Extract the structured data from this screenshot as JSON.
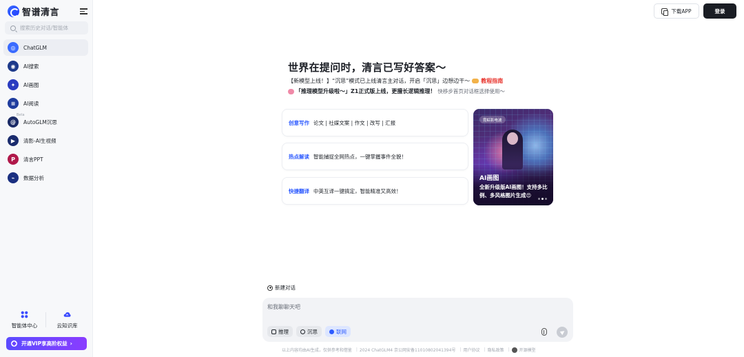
{
  "app": {
    "logo_text": "智谱清言"
  },
  "sidebar": {
    "search_placeholder": "搜索历史对话/智能体",
    "items": [
      {
        "label": "ChatGLM",
        "icon": "chatglm-icon",
        "color": "#3a6bff",
        "active": true
      },
      {
        "label": "AI搜索",
        "icon": "ai-search-icon",
        "color": "#1d3a8a"
      },
      {
        "label": "AI画图",
        "icon": "ai-draw-icon",
        "color": "#2a3cc0"
      },
      {
        "label": "AI阅读",
        "icon": "ai-read-icon",
        "color": "#1f3c9e"
      },
      {
        "label": "AutoGLM沉思",
        "icon": "autoglm-icon",
        "color": "#1a2a66",
        "badge": "Beta"
      },
      {
        "label": "清影-AI生视频",
        "icon": "video-icon",
        "color": "#1b2c6e"
      },
      {
        "label": "清言PPT",
        "icon": "ppt-icon",
        "color": "#b0184a"
      },
      {
        "label": "数据分析",
        "icon": "data-analysis-icon",
        "color": "#1a2f80"
      }
    ],
    "tools": [
      {
        "label": "智能体中心",
        "icon": "agent-center-icon"
      },
      {
        "label": "云知识库",
        "icon": "cloud-kb-icon"
      }
    ],
    "vip_label": "开通VIP享高阶权益"
  },
  "header": {
    "download_label": "下载APP",
    "login_label": "登录"
  },
  "hero": {
    "title": "世界在提问时，清言已写好答案～",
    "notice1_bold": "【新模型上线！】“沉思”模式已上线清言主对话，开启「沉思」边想边干～",
    "notice1_link": "教程指南",
    "notice2_bold": "「推理模型升级啦～」Z1正式版上线，更擅长逻辑推理！",
    "notice2_gray": "快移步首页对话框选择使用～"
  },
  "cards": [
    {
      "tag": "创意写作",
      "text": "论文 | 社媒文案 | 作文 | 改写 | 汇报"
    },
    {
      "tag": "热点解读",
      "text": "智能捕捉全网热点，一键掌握事件全貌！"
    },
    {
      "tag": "快捷翻译",
      "text": "中英互译一键搞定，智能精准又高效！"
    }
  ],
  "promo": {
    "badge": "霓虹影电波",
    "heading": "AI画图",
    "desc": "全新升级版AI画图！支持多比例、多风格图片生成😍"
  },
  "chat": {
    "new_chat_label": "新建对话",
    "input_placeholder": "和我聊聊天吧",
    "modes": [
      {
        "label": "推理",
        "icon": "reasoning-icon",
        "on": false
      },
      {
        "label": "沉思",
        "icon": "contemplate-icon",
        "on": false
      },
      {
        "label": "联网",
        "icon": "web-icon",
        "on": true
      }
    ]
  },
  "footer": {
    "disclaimer": "以上内容均由AI生成，仅供参考和借鉴",
    "copyright": "2024 ChatGLM4 京公网安备11010802041394号",
    "user_agreement": "用户协议",
    "privacy": "隐私政策",
    "open_source": "开源模型"
  }
}
